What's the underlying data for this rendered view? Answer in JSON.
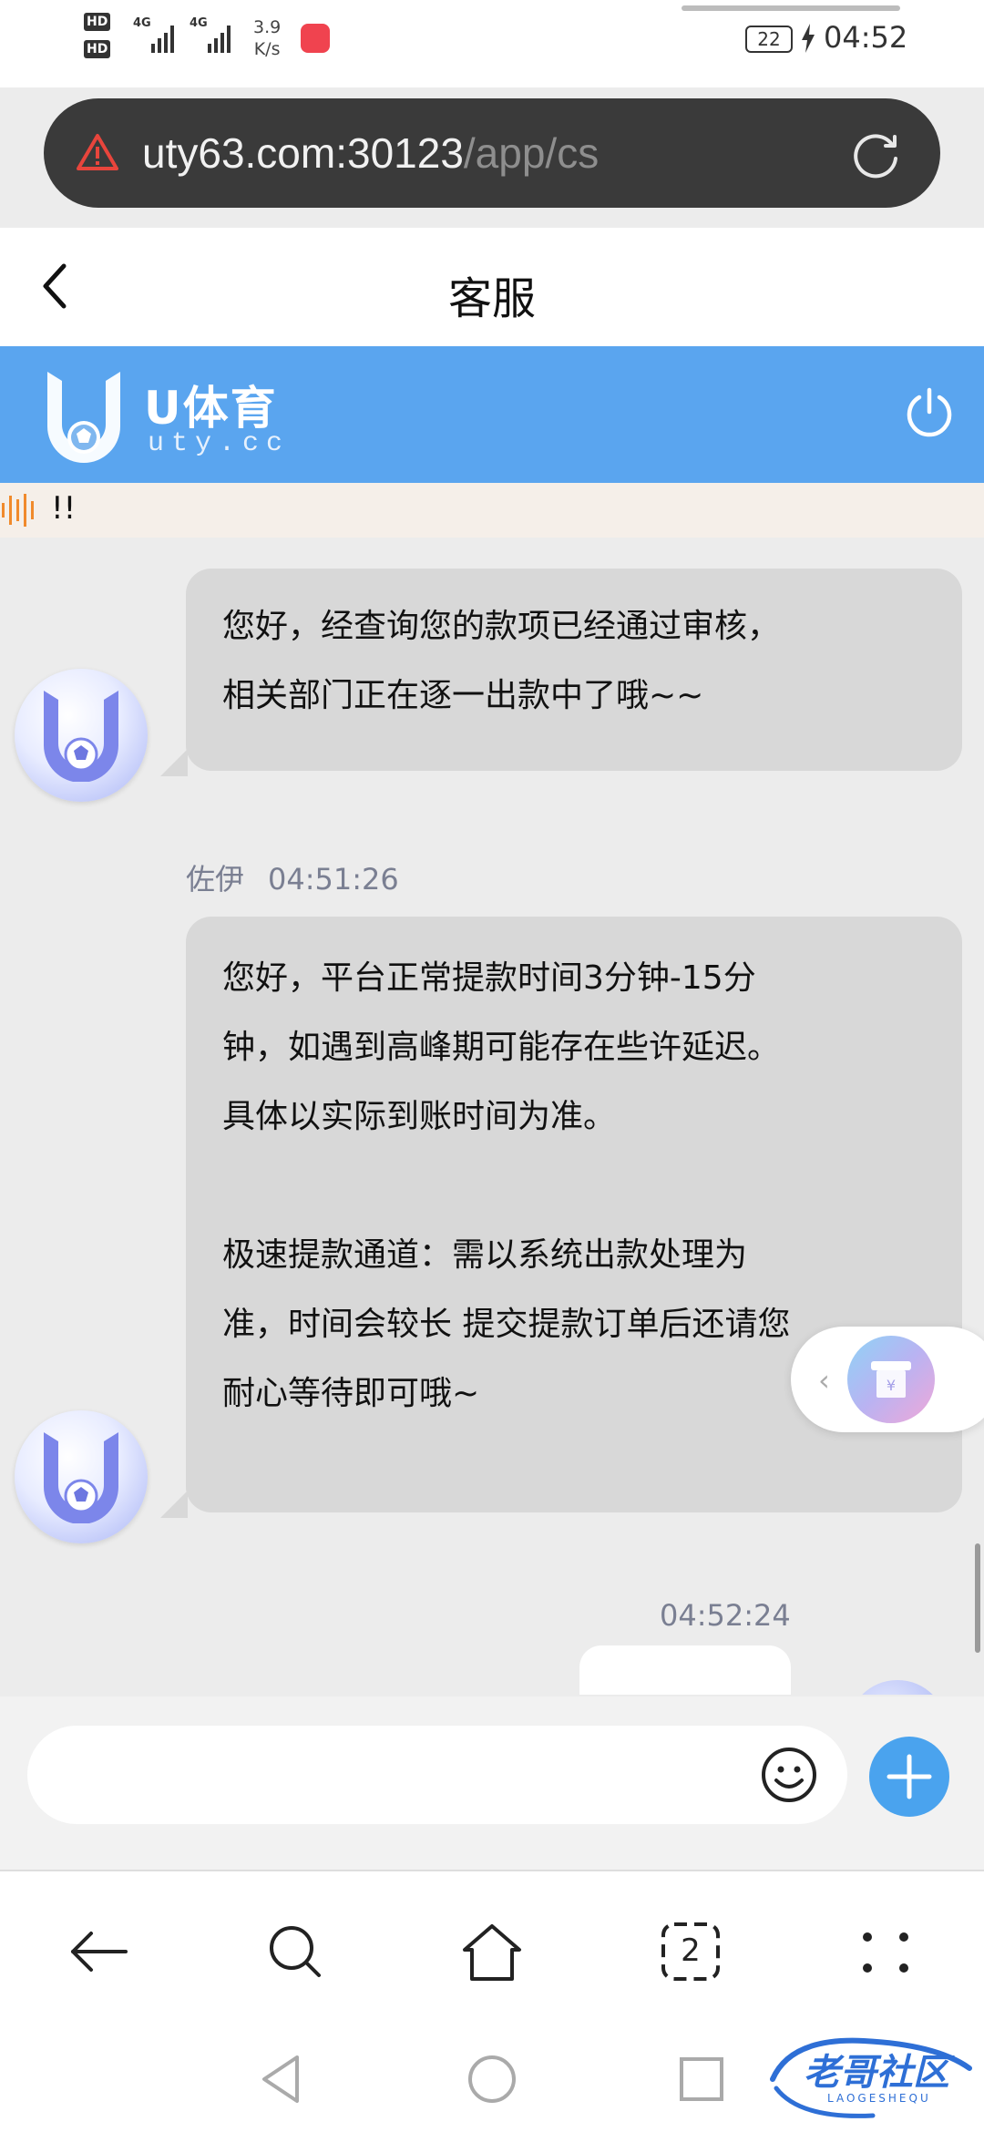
{
  "status_bar": {
    "hd1": "HD",
    "hd2": "HD",
    "net1": "4G",
    "net2": "4G",
    "speed_value": "3.9",
    "speed_unit": "K/s",
    "battery": "22",
    "time": "04:52"
  },
  "url_bar": {
    "host": "uty63.com:30123",
    "path": "/app/cs",
    "warning_icon": "warning-triangle-icon",
    "reload_icon": "reload-icon"
  },
  "title_bar": {
    "title": "客服",
    "back_icon": "chevron-left-icon"
  },
  "brand": {
    "name": "U体育",
    "domain": "uty.cc",
    "header_color": "#5aa5ef",
    "power_icon": "power-icon"
  },
  "marquee": {
    "text": "!!"
  },
  "messages": [
    {
      "sender": "",
      "time": "",
      "text": "您好，经查询您的款项已经通过审核，\n相关部门正在逐一出款中了哦~~"
    },
    {
      "sender": "佐伊",
      "time": "04:51:26",
      "text": "您好，平台正常提款时间3分钟-15分\n钟，如遇到高峰期可能存在些许延迟。\n具体以实际到账时间为准。\n\n极速提款通道：需以系统出款处理为\n准，时间会较长 提交提款订单后还请您\n耐心等待即可哦~"
    },
    {
      "sender": "",
      "time": "04:52:24",
      "text": ""
    }
  ],
  "input_bar": {
    "placeholder": "",
    "emoji_icon": "smiley-icon",
    "plus_icon": "plus-icon",
    "accent": "#4aa3ee"
  },
  "browser_nav": {
    "tab_count": "2"
  },
  "watermark": {
    "text": "老哥社区",
    "sub": "LAOGESHEQU"
  }
}
